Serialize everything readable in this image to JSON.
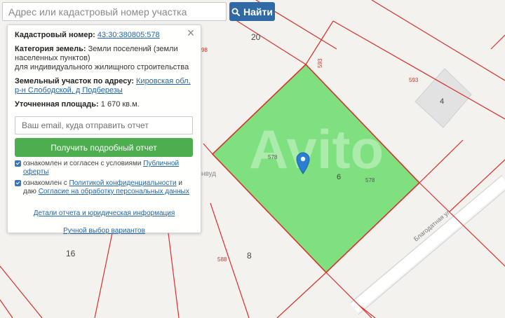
{
  "search": {
    "placeholder": "Адрес или кадастровый номер участка",
    "button_label": "Найти",
    "button_icon": "search-icon"
  },
  "panel": {
    "close_label": "×",
    "cadastral_label": "Кадастровый номер:",
    "cadastral_value": "43:30:380805:578",
    "category_label": "Категория земель:",
    "category_value": "Земли поселений (земли населенных пунктов)",
    "purpose_value": "для индивидуального жилищного строительства",
    "address_label": "Земельный участок по адресу:",
    "address_value": "Кировская обл, р-н Слободской, д Подберезы",
    "area_label": "Уточненная площадь:",
    "area_value": "1 670 кв.м.",
    "email_placeholder": "Ваш email, куда отправить отчет",
    "report_button": "Получить подробный отчет",
    "offer_prefix": "ознакомлен и согласен с условиями",
    "offer_link": "Публичной оферты",
    "privacy_prefix": "ознакомлен с",
    "privacy_link": "Политикой конфиденциальности",
    "privacy_suffix": "и даю",
    "consent_link": "Согласие на обработку персональных данных",
    "details_link": "Детали отчета и юридическая информация",
    "manual_link": "Ручной выбор вариантов"
  },
  "map": {
    "parcel_color": "#7ee07e",
    "boundary_color": "#d9302a",
    "marker_color": "#2a7fd2",
    "watermark": "Avito",
    "labels": {
      "parcel_20": "20",
      "parcel_98": "98",
      "parcel_593_vertical": "593",
      "parcel_593": "593",
      "parcel_4": "4",
      "parcel_578_left": "578",
      "parcel_6": "6",
      "parcel_578_right": "578",
      "street_fragment": "нвуд",
      "street_name": "Благодатная ул",
      "parcel_16": "16",
      "parcel_588": "588",
      "parcel_8": "8"
    }
  }
}
